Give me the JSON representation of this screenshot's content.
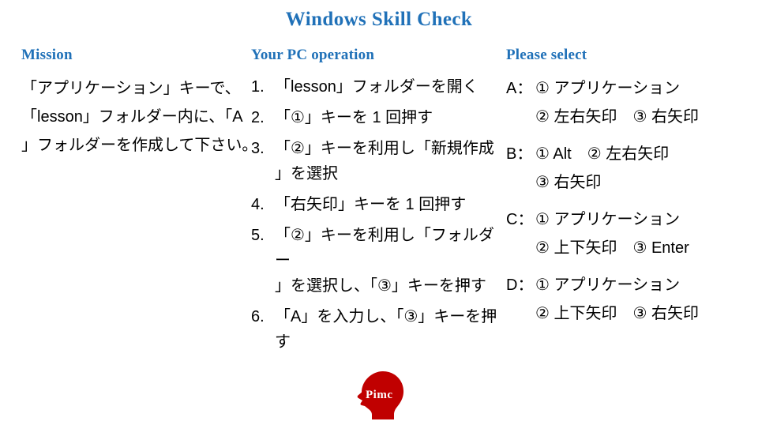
{
  "slide": {
    "title": "Windows Skill Check",
    "accent_blue": "#2071B8",
    "logo_red": "#C00000",
    "background": "#FFFFFF"
  },
  "mission": {
    "heading": "Mission",
    "lines": [
      "「アプリケーション」キーで、",
      "「lesson」フォルダー内に、「A",
      "」フォルダーを作成して下さい。"
    ]
  },
  "operation": {
    "heading": "Your PC operation",
    "steps": [
      {
        "number": "1.",
        "line1": "「lesson」フォルダーを開く",
        "line2": ""
      },
      {
        "number": "2.",
        "line1": "「①」キーを 1 回押す",
        "line2": ""
      },
      {
        "number": "3.",
        "line1": "「②」キーを利用し「新規作成",
        "line2": "」を選択"
      },
      {
        "number": "4.",
        "line1": "「右矢印」キーを 1 回押す",
        "line2": ""
      },
      {
        "number": "5.",
        "line1": "「②」キーを利用し「フォルダー",
        "line2": "」を選択し、「③」キーを押す"
      },
      {
        "number": "6.",
        "line1": "「A」を入力し、「③」キーを押",
        "line2": "す"
      }
    ]
  },
  "select": {
    "heading": "Please select",
    "options": [
      {
        "key": "A：",
        "line1": "① アプリケーション",
        "line2": "② 左右矢印　③ 右矢印"
      },
      {
        "key": "B：",
        "line1": "① Alt　② 左右矢印",
        "line2": "③ 右矢印"
      },
      {
        "key": "C：",
        "line1": "① アプリケーション",
        "line2": "② 上下矢印　③ Enter"
      },
      {
        "key": "D：",
        "line1": "① アプリケーション",
        "line2": "② 上下矢印　③ 右矢印"
      }
    ]
  },
  "logo": {
    "name": "Pimc",
    "alt": "head-silhouette-logo"
  }
}
